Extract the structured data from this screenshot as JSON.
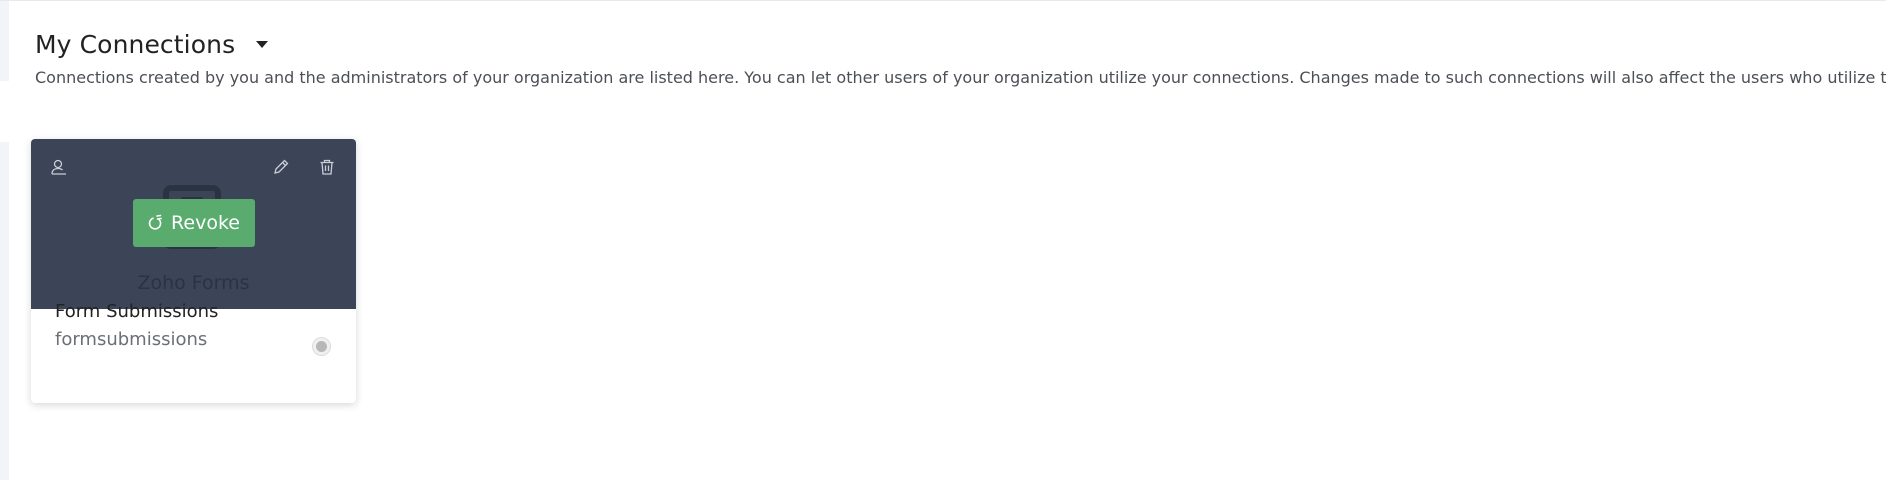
{
  "header": {
    "title": "My Connections",
    "dropdown_icon": "caret-down-icon",
    "description": "Connections created by you and the administrators of your organization are listed here. You can let other users of your organization utilize your connections. Changes made to such connections will also affect the users who utilize them."
  },
  "connections": [
    {
      "app_name": "Zoho Forms",
      "name": "Form Submissions",
      "link_name": "formsubmissions",
      "revoke_label": "Revoke",
      "icons": {
        "share": "share-user-icon",
        "edit": "pencil-icon",
        "delete": "trash-icon",
        "revoke": "plug-icon"
      },
      "status": "inactive"
    }
  ],
  "colors": {
    "card_header": "#3b4557",
    "revoke_button": "#5aac6e",
    "title_text": "#222222",
    "secondary_text": "#6b6f76"
  }
}
